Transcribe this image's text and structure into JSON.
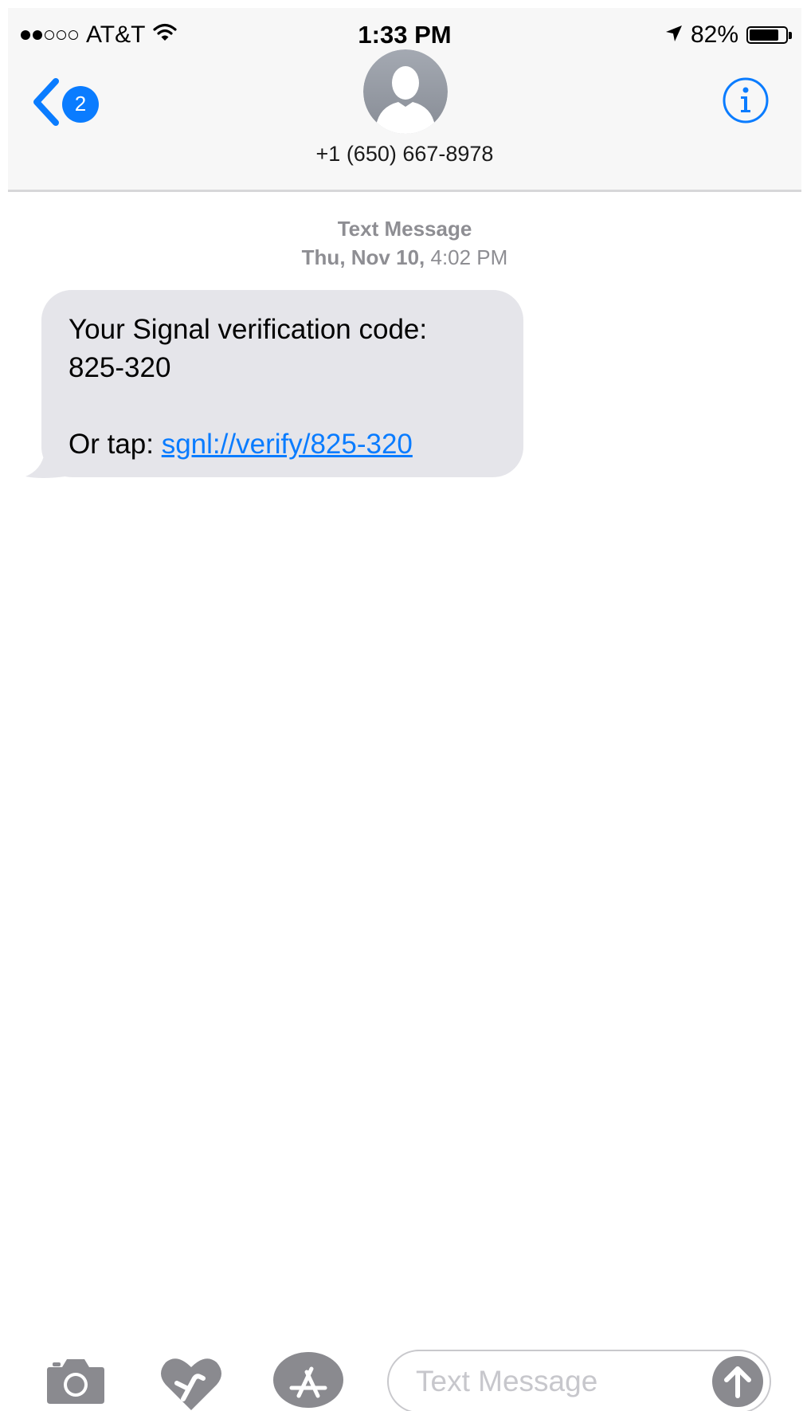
{
  "status_bar": {
    "signal_full": 2,
    "signal_total": 5,
    "carrier": "AT&T",
    "time": "1:33 PM",
    "battery_percent": "82%",
    "battery_level": 0.82
  },
  "nav": {
    "back_badge": "2",
    "contact": "+1 (650) 667-8978"
  },
  "conversation": {
    "kind_label": "Text Message",
    "day": "Thu, Nov 10,",
    "time": "4:02 PM",
    "message": {
      "line1": "Your Signal verification code:",
      "line2": "825-320",
      "tap_label": "Or tap: ",
      "link": "sgnl://verify/825-320"
    }
  },
  "input_bar": {
    "placeholder": "Text Message"
  },
  "colors": {
    "accent": "#0a7cff",
    "bubble": "#e5e5ea",
    "secondary_text": "#8e8e93",
    "icon_gray": "#8a8a8f"
  },
  "icons": [
    "wifi-icon",
    "location-arrow-icon",
    "battery-icon",
    "back-chevron-icon",
    "contact-avatar-icon",
    "info-icon",
    "camera-icon",
    "digital-touch-icon",
    "app-store-icon",
    "send-arrow-icon"
  ]
}
